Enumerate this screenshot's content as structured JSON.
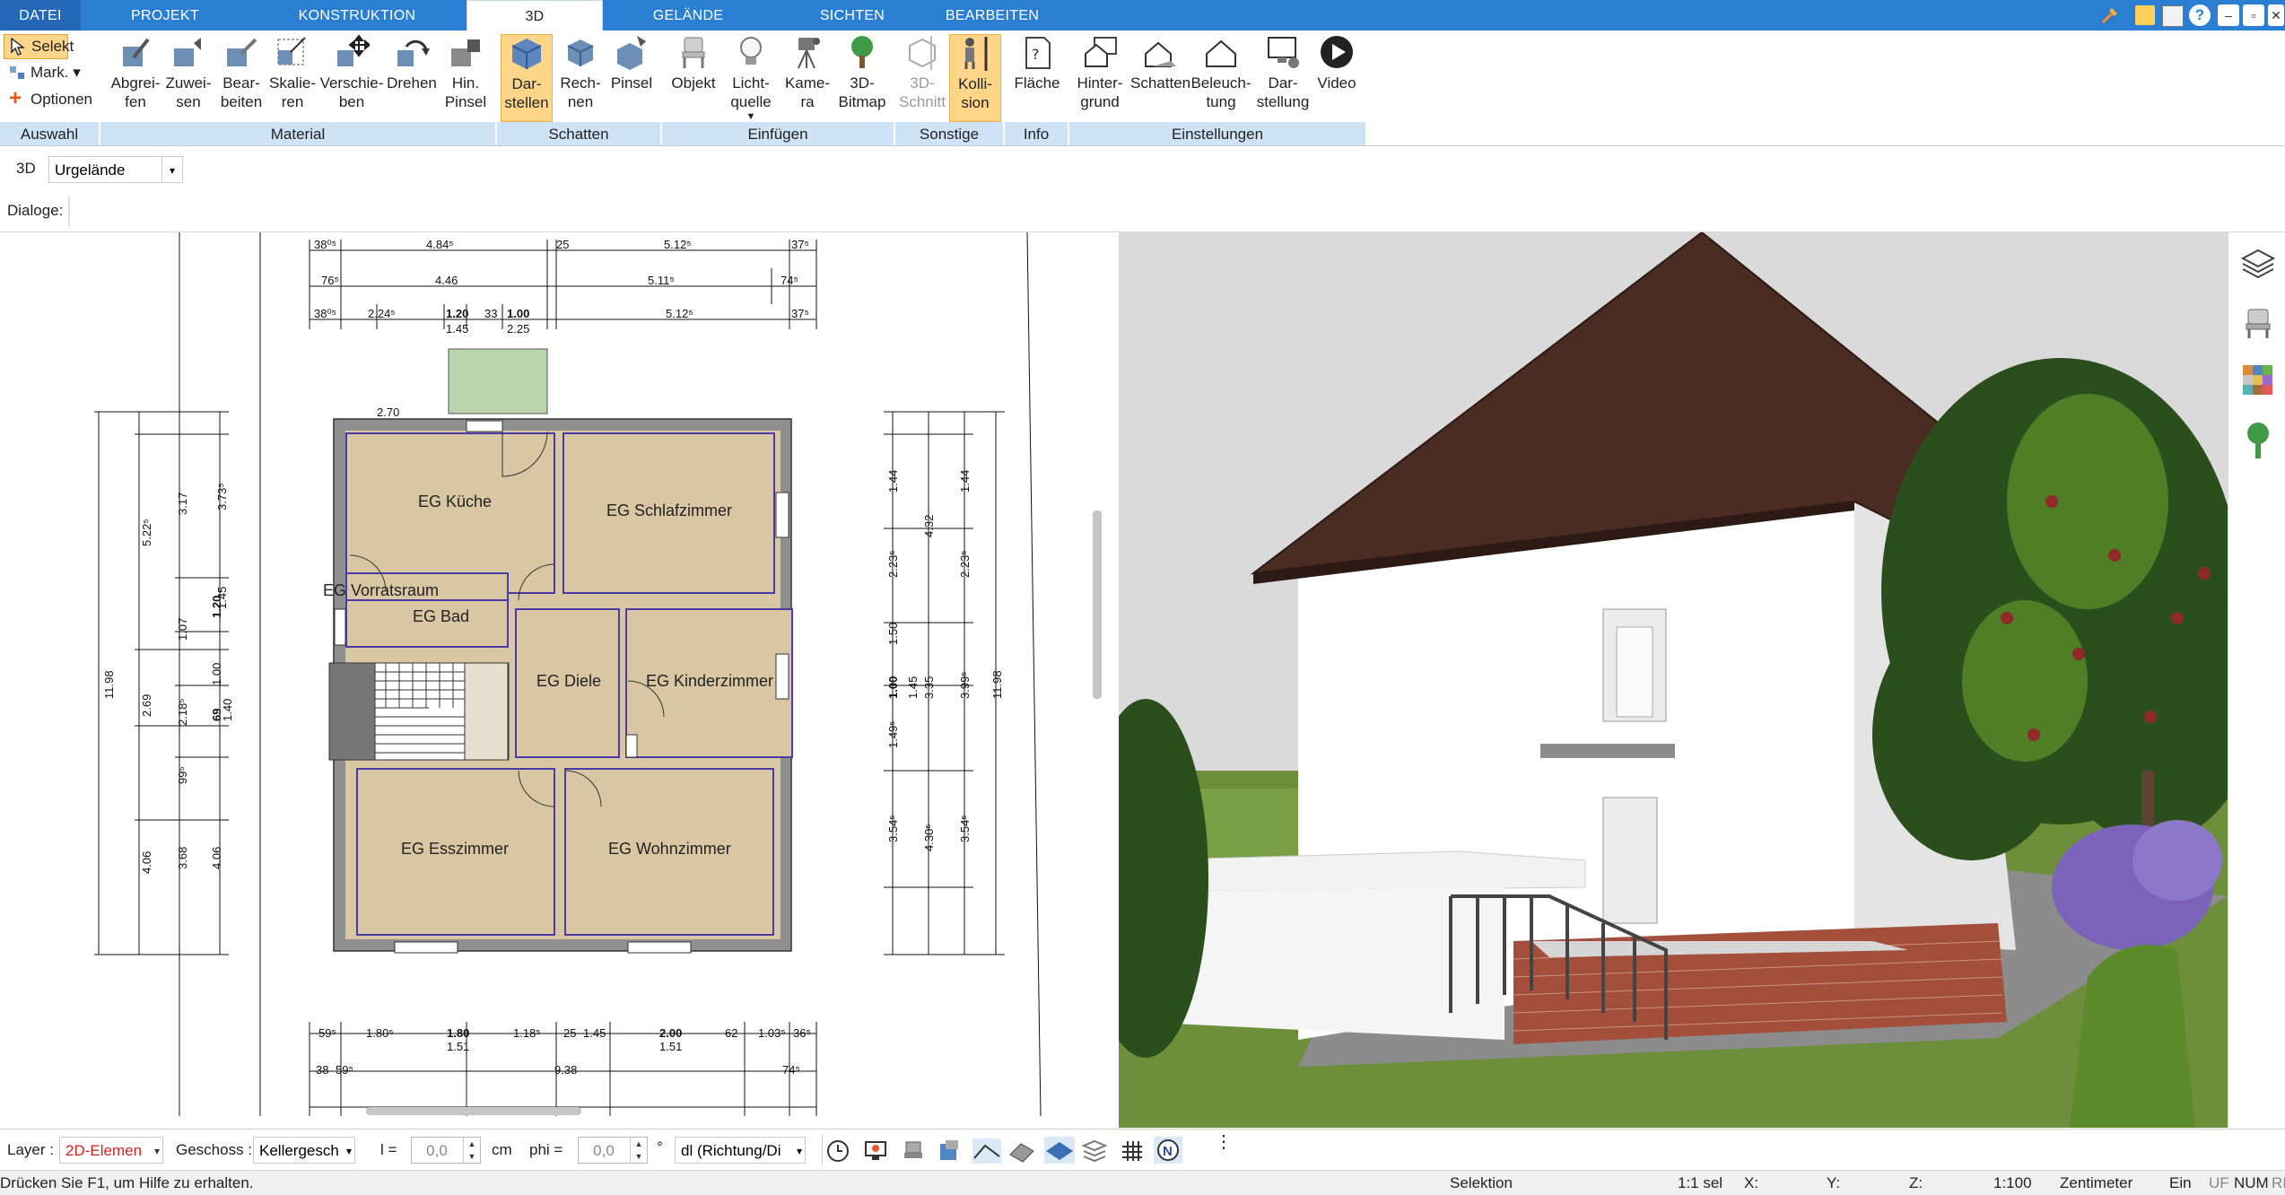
{
  "ribbon_tabs": [
    "DATEI",
    "PROJEKT",
    "KONSTRUKTION",
    "3D",
    "GELÄNDE",
    "SICHTEN",
    "BEARBEITEN"
  ],
  "selection": {
    "selekt": "Selekt",
    "mark": "Mark.",
    "optionen": "Optionen"
  },
  "buttons": {
    "abgreifen": "Abgrei-\nfen",
    "zuweisen": "Zuwei-\nsen",
    "bearbeiten": "Bear-\nbeiten",
    "skalieren": "Skalie-\nren",
    "verschieben": "Verschie-\nben",
    "drehen": "Drehen",
    "hin_pinsel": "Hin.\nPinsel",
    "darstellen": "Dar-\nstellen",
    "rechnen": "Rech-\nnen",
    "pinsel": "Pinsel",
    "objekt": "Objekt",
    "lichtquelle": "Licht-\nquelle",
    "kamera": "Kame-\nra",
    "bitmap3d": "3D-\nBitmap",
    "schnitt3d": "3D-\nSchnitt",
    "kollision": "Kolli-\nsion",
    "flaeche": "Fläche",
    "hintergrund": "Hinter-\ngrund",
    "schatten": "Schatten",
    "beleuchtung": "Beleuch-\ntung",
    "darstellung": "Dar-\nstellung",
    "video": "Video"
  },
  "groups": {
    "auswahl": "Auswahl",
    "material": "Material",
    "schatten": "Schatten",
    "einfuegen": "Einfügen",
    "sonstige": "Sonstige",
    "info": "Info",
    "einstellungen": "Einstellungen"
  },
  "subbar": {
    "mode": "3D",
    "terrain": "Urgelände"
  },
  "dialoge_label": "Dialoge:",
  "rooms": [
    "EG Küche",
    "EG Schlafzimmer",
    "EG Vorratsraum",
    "EG Bad",
    "EG Diele",
    "EG Kinderzimmer",
    "EG Esszimmer",
    "EG Wohnzimmer"
  ],
  "dimensions": {
    "top1": [
      "38⁰⁵",
      "4.84⁵",
      "25",
      "5.12⁵",
      "37⁵"
    ],
    "top2": [
      "76⁵",
      "4.46",
      "5.11⁵",
      "74⁵"
    ],
    "top3": [
      "38⁰⁵",
      "2.24⁵",
      "1.20",
      "1.45",
      "33",
      "1.00",
      "2.25",
      "5.12⁵",
      "37⁵"
    ],
    "bottom1": [
      "59⁵",
      "1.80⁵",
      "1.80",
      "1.51",
      "1.18⁵",
      "25",
      "1.45",
      "2.00",
      "1.51",
      "62",
      "1.03⁵",
      "36⁵"
    ],
    "bottom2": [
      "38",
      "59⁵",
      "9.38",
      "74⁵"
    ],
    "left_total": "11.98",
    "left_a": [
      "5.22⁵",
      "2.69",
      "4.06"
    ],
    "left_b": [
      "3.17",
      "1.07",
      "2.18⁵",
      "99⁵",
      "3.68"
    ],
    "left_c": [
      "3.73⁵",
      "1.45",
      "1.20",
      "1.00",
      "69",
      "1.40",
      "4.06"
    ],
    "right_total": "11.98",
    "right_a": [
      "1.44",
      "2.23⁵",
      "1.50",
      "1.00",
      "1.49⁵",
      "3.54⁵"
    ],
    "right_b": [
      "4.32",
      "1.45",
      "3.35",
      "4.30⁵"
    ],
    "right_c": [
      "1.44",
      "2.23⁵",
      "3.99⁵",
      "3.54⁵"
    ],
    "balcony": "2.70"
  },
  "bottom_toolbar": {
    "layer_label": "Layer :",
    "layer_value": "2D-Elemen",
    "geschoss_label": "Geschoss :",
    "geschoss_value": "Kellergesch",
    "l_label": "l =",
    "l_value": "0,0",
    "l_unit": "cm",
    "phi_label": "phi =",
    "phi_value": "0,0",
    "phi_unit": "°",
    "dl_value": "dl (Richtung/Di"
  },
  "status": {
    "help": "Drücken Sie F1, um Hilfe zu erhalten.",
    "mode": "Selektion",
    "sel": "1:1 sel",
    "x": "X:",
    "y": "Y:",
    "z": "Z:",
    "scale": "1:100",
    "unit": "Zentimeter",
    "ein": "Ein",
    "uf": "UF",
    "num": "NUM",
    "ri": "RI"
  },
  "colors": {
    "tab_blue": "#2b7fd3",
    "group_blue": "#cfe3f7",
    "highlight": "#ffd58a",
    "wall": "#8f8f8f",
    "floor": "#d9c7a3",
    "room_border": "#4a3aa8",
    "roof": "#4a2c22",
    "lawn": "#6d8f3c"
  }
}
